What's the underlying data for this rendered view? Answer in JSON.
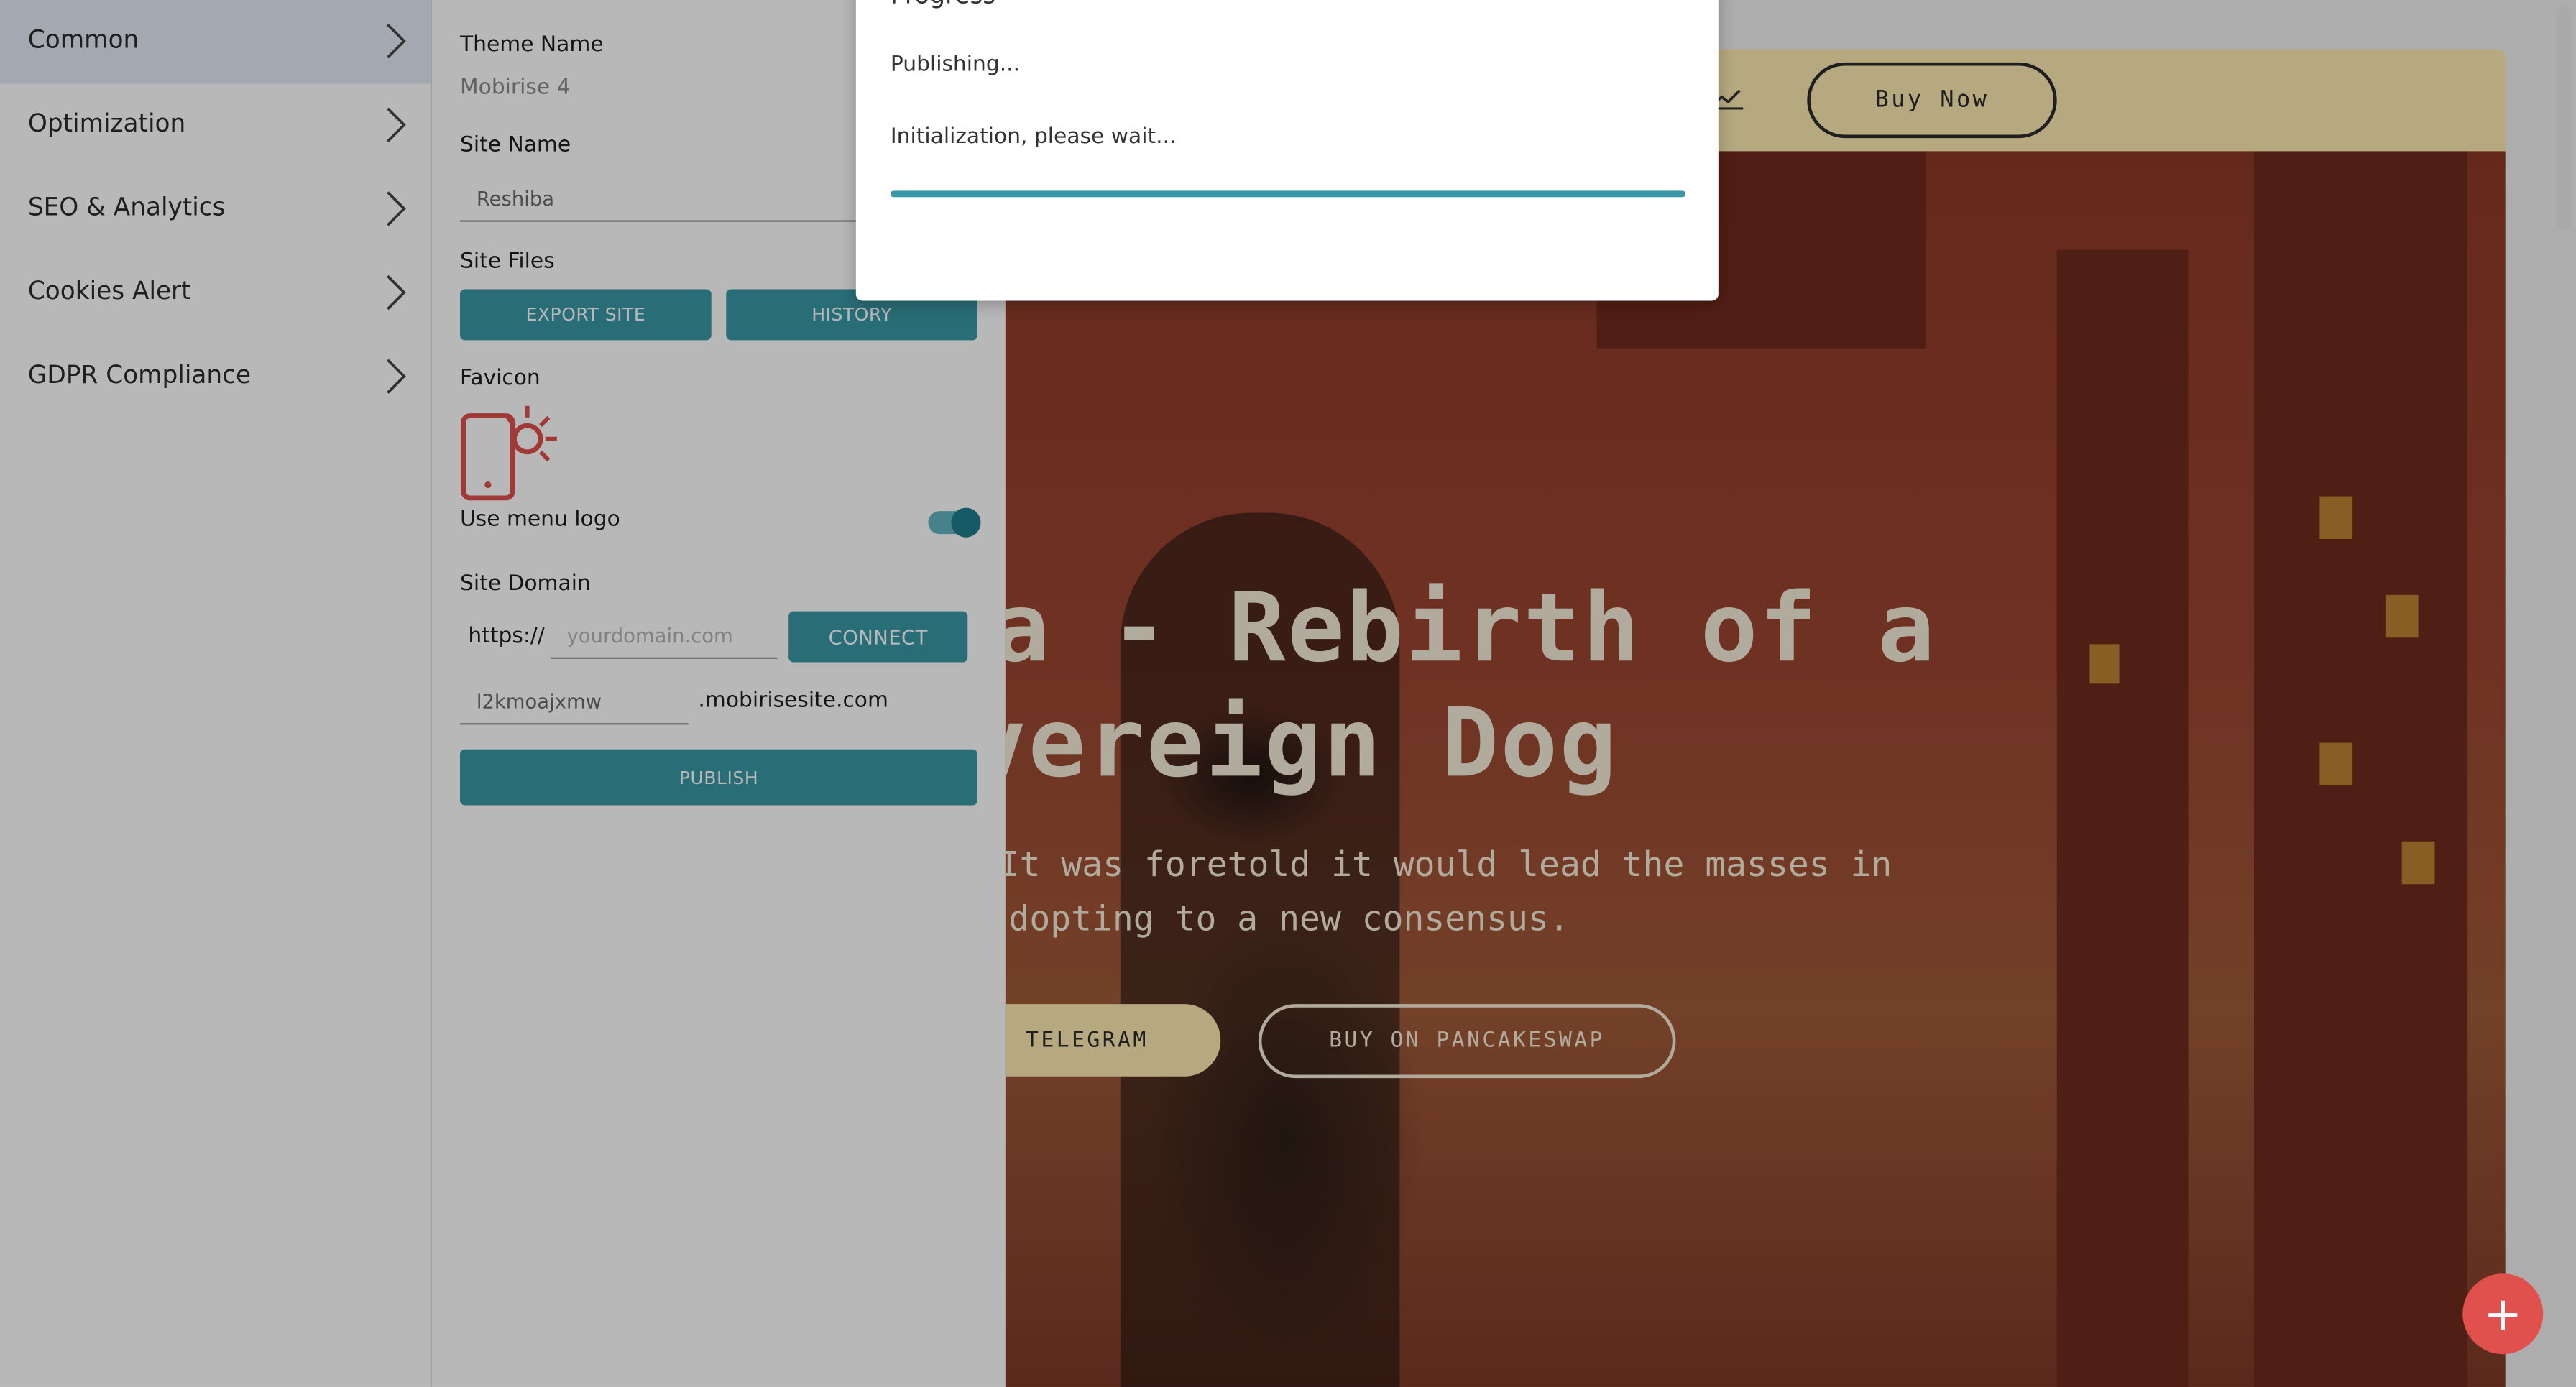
{
  "sidebar": {
    "items": [
      {
        "label": "Common"
      },
      {
        "label": "Optimization"
      },
      {
        "label": "SEO & Analytics"
      },
      {
        "label": "Cookies Alert"
      },
      {
        "label": "GDPR Compliance"
      }
    ]
  },
  "settings": {
    "theme_name_label": "Theme Name",
    "theme_name_value": "Mobirise 4",
    "site_name_label": "Site Name",
    "site_name_value": "Reshiba",
    "site_files_label": "Site Files",
    "export_button": "EXPORT SITE",
    "history_button": "HISTORY",
    "favicon_label": "Favicon",
    "use_menu_logo_label": "Use menu logo",
    "use_menu_logo_on": true,
    "site_domain_label": "Site Domain",
    "domain_prefix": "https://",
    "domain_placeholder": "yourdomain.com",
    "connect_button": "CONNECT",
    "subdomain_value": "l2kmoajxmw",
    "subdomain_suffix": ".mobirisesite.com",
    "publish_button": "PUBLISH"
  },
  "preview": {
    "nav_button": "Buy Now",
    "hero_title_line1": "a - Rebirth of a",
    "hero_title_line2": "vereign Dog",
    "hero_text_line1": "It was foretold it would lead the masses in",
    "hero_text_line2": "dopting to a new consensus.",
    "telegram_button": "TELEGRAM",
    "pancakeswap_button": "BUY ON PANCAKESWAP"
  },
  "modal": {
    "title": "Progress",
    "status": "Publishing...",
    "message": "Initialization, please wait...",
    "progress": 1.0
  },
  "fab_icon": "plus-icon",
  "colors": {
    "accent": "#3a98a6",
    "fab": "#e0504c",
    "navbar": "#fdeab0"
  }
}
